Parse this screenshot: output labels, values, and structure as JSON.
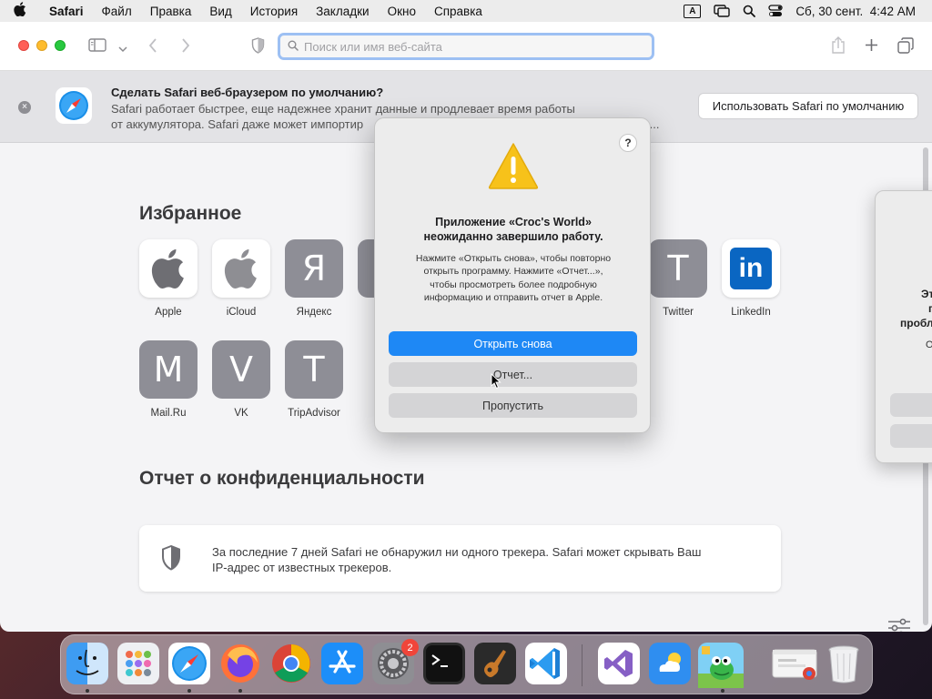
{
  "menubar": {
    "app_name": "Safari",
    "items": [
      "Файл",
      "Правка",
      "Вид",
      "История",
      "Закладки",
      "Окно",
      "Справка"
    ],
    "input_indicator": "A",
    "datetime": "Сб, 30 сент.  4:42 AM"
  },
  "toolbar": {
    "url_placeholder": "Поиск или имя веб-сайта"
  },
  "banner": {
    "title": "Сделать Safari веб-браузером по умолчанию?",
    "desc_line1": "Safari работает быстрее, еще надежнее хранит данные и продлевает время работы",
    "desc_line2": "от аккумулятора. Safari даже может импортир",
    "desc_tail": "ае...",
    "button": "Использовать Safari по умолчанию"
  },
  "favorites": {
    "heading": "Избранное",
    "items": [
      {
        "label": "Apple",
        "glyph": ""
      },
      {
        "label": "iCloud",
        "glyph": ""
      },
      {
        "label": "Яндекс",
        "glyph": "Я"
      },
      {
        "label": "Twitter",
        "glyph": "T"
      },
      {
        "label": "LinkedIn",
        "glyph": "in"
      },
      {
        "label": "Mail.Ru",
        "glyph": "M"
      },
      {
        "label": "VK",
        "glyph": "V"
      },
      {
        "label": "TripAdvisor",
        "glyph": "T"
      }
    ]
  },
  "privacy": {
    "heading": "Отчет о конфиденциальности",
    "line1": "За последние 7 дней Safari не обнаружил ни одного трекера. Safari может скрывать Ваш",
    "line2": "IP-адрес от известных трекеров."
  },
  "crash_dialog": {
    "help": "?",
    "title_line1": "Приложение «Croc's World»",
    "title_line2": "неожиданно завершило работу.",
    "msg_line1": "Нажмите «Открыть снова», чтобы повторно",
    "msg_line2": "открыть программу. Нажмите «Отчет...»,",
    "msg_line3": "чтобы просмотреть более подробную",
    "msg_line4": "информацию и отправить отчет в Apple.",
    "btn_reopen": "Открыть снова",
    "btn_report": "Отчет...",
    "btn_skip": "Пропустить"
  },
  "side_dialog": {
    "t1": "Эт",
    "t2": "п",
    "t3": "пробл",
    "t4": "О"
  },
  "dock": {
    "apps": [
      "finder-icon",
      "launchpad-icon",
      "safari-icon",
      "firefox-icon",
      "chrome-icon",
      "app-store-icon",
      "system-settings-icon",
      "terminal-icon",
      "garageband-icon",
      "vscode-icon",
      "visual-studio-icon",
      "weather-icon",
      "crocs-world-icon",
      "chrome-window-icon",
      "trash-icon"
    ],
    "settings_badge": "2"
  },
  "colors": {
    "accent": "#1e88f5",
    "tile_gray": "#8e8e96",
    "warning": "#f7c21a"
  }
}
